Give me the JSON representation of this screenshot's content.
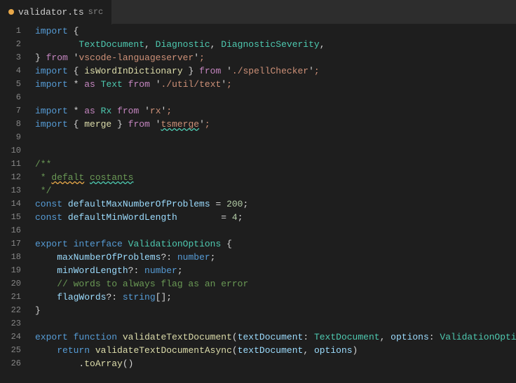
{
  "tab": {
    "dot": true,
    "filename": "validator.ts",
    "path": "src"
  },
  "lines": [
    {
      "num": 1,
      "tokens": [
        {
          "t": "kw",
          "v": "import"
        },
        {
          "t": "punct",
          "v": " { "
        }
      ]
    },
    {
      "num": 2,
      "tokens": [
        {
          "t": "",
          "v": "        "
        },
        {
          "t": "type",
          "v": "TextDocument"
        },
        {
          "t": "punct",
          "v": ", "
        },
        {
          "t": "type",
          "v": "Diagnostic"
        },
        {
          "t": "punct",
          "v": ", "
        },
        {
          "t": "type",
          "v": "DiagnosticSeverity"
        },
        {
          "t": "punct",
          "v": ","
        }
      ]
    },
    {
      "num": 3,
      "tokens": [
        {
          "t": "punct",
          "v": "} "
        },
        {
          "t": "kw2",
          "v": "from"
        },
        {
          "t": "punct",
          "v": " '"
        },
        {
          "t": "str",
          "v": "vscode-languageserver"
        },
        {
          "t": "punct",
          "v": "'"
        },
        {
          "t": "str",
          "v": ";"
        }
      ]
    },
    {
      "num": 4,
      "tokens": [
        {
          "t": "kw",
          "v": "import"
        },
        {
          "t": "punct",
          "v": " { "
        },
        {
          "t": "fn",
          "v": "isWordInDictionary"
        },
        {
          "t": "punct",
          "v": " } "
        },
        {
          "t": "kw2",
          "v": "from"
        },
        {
          "t": "punct",
          "v": " '"
        },
        {
          "t": "str",
          "v": "./spellChecker"
        },
        {
          "t": "punct",
          "v": "'"
        },
        {
          "t": "str",
          "v": ";"
        }
      ]
    },
    {
      "num": 5,
      "tokens": [
        {
          "t": "kw",
          "v": "import"
        },
        {
          "t": "punct",
          "v": " * "
        },
        {
          "t": "kw2",
          "v": "as"
        },
        {
          "t": "punct",
          "v": " "
        },
        {
          "t": "type",
          "v": "Text"
        },
        {
          "t": "punct",
          "v": " "
        },
        {
          "t": "kw2",
          "v": "from"
        },
        {
          "t": "punct",
          "v": " '"
        },
        {
          "t": "str",
          "v": "./util/text"
        },
        {
          "t": "punct",
          "v": "'"
        },
        {
          "t": "str",
          "v": ";"
        }
      ]
    },
    {
      "num": 6,
      "tokens": []
    },
    {
      "num": 7,
      "tokens": [
        {
          "t": "kw",
          "v": "import"
        },
        {
          "t": "punct",
          "v": " * "
        },
        {
          "t": "kw2",
          "v": "as"
        },
        {
          "t": "punct",
          "v": " "
        },
        {
          "t": "type",
          "v": "Rx"
        },
        {
          "t": "punct",
          "v": " "
        },
        {
          "t": "kw2",
          "v": "from"
        },
        {
          "t": "punct",
          "v": " '"
        },
        {
          "t": "str",
          "v": "rx"
        },
        {
          "t": "punct",
          "v": "'"
        },
        {
          "t": "str",
          "v": ";"
        }
      ]
    },
    {
      "num": 8,
      "tokens": [
        {
          "t": "kw",
          "v": "import"
        },
        {
          "t": "punct",
          "v": " { "
        },
        {
          "t": "fn",
          "v": "merge"
        },
        {
          "t": "punct",
          "v": " } "
        },
        {
          "t": "kw2",
          "v": "from"
        },
        {
          "t": "punct",
          "v": " '"
        },
        {
          "t": "str squiggly-green",
          "v": "tsmerge"
        },
        {
          "t": "punct",
          "v": "'"
        },
        {
          "t": "str",
          "v": ";"
        }
      ]
    },
    {
      "num": 9,
      "tokens": []
    },
    {
      "num": 10,
      "tokens": []
    },
    {
      "num": 11,
      "tokens": [
        {
          "t": "comment",
          "v": "/**"
        }
      ]
    },
    {
      "num": 12,
      "tokens": [
        {
          "t": "comment",
          "v": " * "
        },
        {
          "t": "comment squiggly-yellow",
          "v": "defalt"
        },
        {
          "t": "comment",
          "v": " "
        },
        {
          "t": "comment squiggly-green",
          "v": "costants"
        }
      ]
    },
    {
      "num": 13,
      "tokens": [
        {
          "t": "comment",
          "v": " */"
        }
      ]
    },
    {
      "num": 14,
      "tokens": [
        {
          "t": "kw",
          "v": "const"
        },
        {
          "t": "punct",
          "v": " "
        },
        {
          "t": "param",
          "v": "defaultMaxNumberOfProblems"
        },
        {
          "t": "punct",
          "v": " = "
        },
        {
          "t": "num",
          "v": "200"
        },
        {
          "t": "punct",
          "v": ";"
        }
      ]
    },
    {
      "num": 15,
      "tokens": [
        {
          "t": "kw",
          "v": "const"
        },
        {
          "t": "punct",
          "v": " "
        },
        {
          "t": "param",
          "v": "defaultMinWordLength"
        },
        {
          "t": "punct",
          "v": "        = "
        },
        {
          "t": "num",
          "v": "4"
        },
        {
          "t": "punct",
          "v": ";"
        }
      ]
    },
    {
      "num": 16,
      "tokens": []
    },
    {
      "num": 17,
      "tokens": [
        {
          "t": "kw",
          "v": "export"
        },
        {
          "t": "punct",
          "v": " "
        },
        {
          "t": "kw",
          "v": "interface"
        },
        {
          "t": "punct",
          "v": " "
        },
        {
          "t": "type",
          "v": "ValidationOptions"
        },
        {
          "t": "punct",
          "v": " {"
        }
      ]
    },
    {
      "num": 18,
      "tokens": [
        {
          "t": "punct",
          "v": "    "
        },
        {
          "t": "param",
          "v": "maxNumberOfProblems"
        },
        {
          "t": "punct",
          "v": "?: "
        },
        {
          "t": "kw",
          "v": "number"
        },
        {
          "t": "punct",
          "v": ";"
        }
      ]
    },
    {
      "num": 19,
      "tokens": [
        {
          "t": "punct",
          "v": "    "
        },
        {
          "t": "param",
          "v": "minWordLength"
        },
        {
          "t": "punct",
          "v": "?: "
        },
        {
          "t": "kw",
          "v": "number"
        },
        {
          "t": "punct",
          "v": ";"
        }
      ]
    },
    {
      "num": 20,
      "tokens": [
        {
          "t": "comment",
          "v": "    // words to always flag as an error"
        }
      ]
    },
    {
      "num": 21,
      "tokens": [
        {
          "t": "punct",
          "v": "    "
        },
        {
          "t": "param",
          "v": "flagWords"
        },
        {
          "t": "punct",
          "v": "?: "
        },
        {
          "t": "kw",
          "v": "string"
        },
        {
          "t": "punct",
          "v": "[]"
        },
        {
          "t": "punct",
          "v": ";"
        }
      ]
    },
    {
      "num": 22,
      "tokens": [
        {
          "t": "punct",
          "v": "}"
        }
      ]
    },
    {
      "num": 23,
      "tokens": []
    },
    {
      "num": 24,
      "tokens": [
        {
          "t": "kw",
          "v": "export"
        },
        {
          "t": "punct",
          "v": " "
        },
        {
          "t": "kw",
          "v": "function"
        },
        {
          "t": "punct",
          "v": " "
        },
        {
          "t": "fn",
          "v": "validateTextDocument"
        },
        {
          "t": "punct",
          "v": "("
        },
        {
          "t": "param",
          "v": "textDocument"
        },
        {
          "t": "punct",
          "v": ": "
        },
        {
          "t": "type",
          "v": "TextDocument"
        },
        {
          "t": "punct",
          "v": ", "
        },
        {
          "t": "param",
          "v": "options"
        },
        {
          "t": "punct",
          "v": ": "
        },
        {
          "t": "type",
          "v": "ValidationOpti"
        }
      ]
    },
    {
      "num": 25,
      "tokens": [
        {
          "t": "punct",
          "v": "    "
        },
        {
          "t": "kw",
          "v": "return"
        },
        {
          "t": "punct",
          "v": " "
        },
        {
          "t": "fn",
          "v": "validateTextDocumentAsync"
        },
        {
          "t": "punct",
          "v": "("
        },
        {
          "t": "param",
          "v": "textDocument"
        },
        {
          "t": "punct",
          "v": ", "
        },
        {
          "t": "param",
          "v": "options"
        },
        {
          "t": "punct",
          "v": ")"
        }
      ]
    },
    {
      "num": 26,
      "tokens": [
        {
          "t": "punct",
          "v": "        ."
        },
        {
          "t": "fn",
          "v": "toArray"
        },
        {
          "t": "punct",
          "v": "()"
        }
      ]
    }
  ]
}
